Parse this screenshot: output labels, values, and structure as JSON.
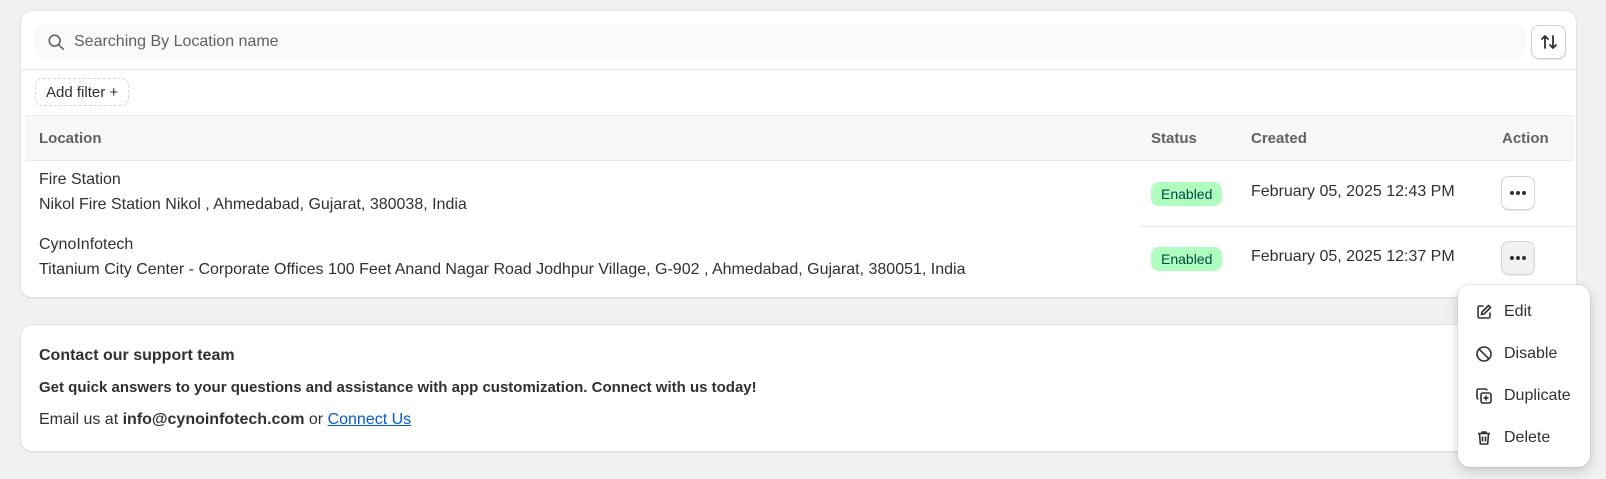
{
  "search": {
    "placeholder": "Searching By Location name"
  },
  "filter": {
    "add_label": "Add filter +"
  },
  "table": {
    "headers": {
      "location": "Location",
      "status": "Status",
      "created": "Created",
      "action": "Action"
    },
    "rows": [
      {
        "name": "Fire Station",
        "address": "Nikol Fire Station Nikol , Ahmedabad, Gujarat, 380038, India",
        "status": "Enabled",
        "created": "February 05, 2025 12:43 PM"
      },
      {
        "name": "CynoInfotech",
        "address": "Titanium City Center - Corporate Offices 100 Feet Anand Nagar Road Jodhpur Village, G-902 , Ahmedabad, Gujarat, 380051, India",
        "status": "Enabled",
        "created": "February 05, 2025 12:37 PM"
      }
    ]
  },
  "support": {
    "title": "Contact our support team",
    "description": "Get quick answers to your questions and assistance with app customization. Connect with us today!",
    "email_prefix": "Email us at",
    "email": "info@cynoinfotech.com",
    "or": "or",
    "link": "Connect Us"
  },
  "action_menu": {
    "items": [
      {
        "label": "Edit",
        "icon": "edit-icon"
      },
      {
        "label": "Disable",
        "icon": "disable-icon"
      },
      {
        "label": "Duplicate",
        "icon": "duplicate-icon"
      },
      {
        "label": "Delete",
        "icon": "delete-icon"
      }
    ]
  },
  "colors": {
    "page_bg": "#f1f1f1",
    "badge_bg": "#affebf",
    "badge_text": "#014b40",
    "link": "#005bd3"
  }
}
